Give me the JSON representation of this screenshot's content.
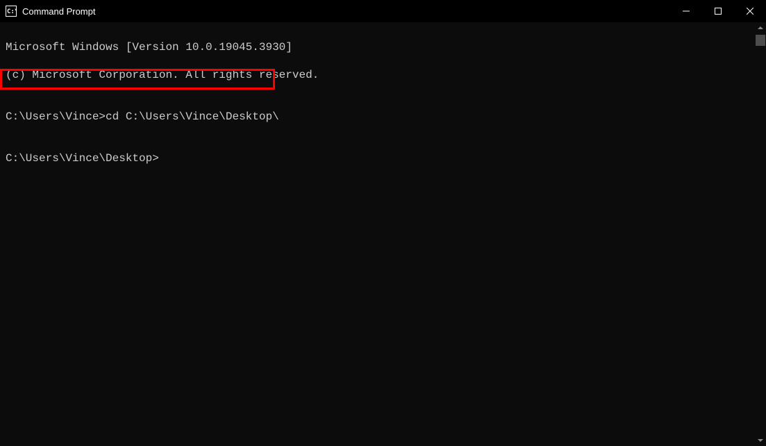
{
  "titlebar": {
    "icon_text": "C:\\",
    "title": "Command Prompt"
  },
  "terminal": {
    "line1": "Microsoft Windows [Version 10.0.19045.3930]",
    "line2": "(c) Microsoft Corporation. All rights reserved.",
    "blank1": "",
    "prompt1_prefix": "C:\\Users\\Vince>",
    "prompt1_command": "cd C:\\Users\\Vince\\Desktop\\",
    "blank2": "",
    "prompt2": "C:\\Users\\Vince\\Desktop>"
  }
}
